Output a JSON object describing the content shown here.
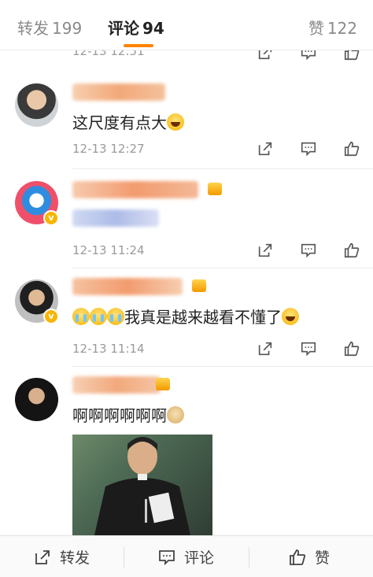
{
  "tabs": {
    "repost_label": "转发",
    "repost_count": "199",
    "comment_label": "评论",
    "comment_count": "94",
    "like_label": "赞",
    "like_count": "122"
  },
  "comments": [
    {
      "cut_time": "12-13 12:51"
    },
    {
      "text": "这尺度有点大",
      "time": "12-13 12:27"
    },
    {
      "text": "",
      "time": "12-13 11:24"
    },
    {
      "text": "我真是越来越看不懂了",
      "time": "12-13 11:14"
    },
    {
      "text": "啊啊啊啊啊啊",
      "time": ""
    }
  ],
  "bottom_bar": {
    "repost_label": "转发",
    "comment_label": "评论",
    "like_label": "赞"
  },
  "colors": {
    "accent": "#ff8200",
    "verified_badge": "#f8b500",
    "muted_text": "#9a9a9a"
  }
}
